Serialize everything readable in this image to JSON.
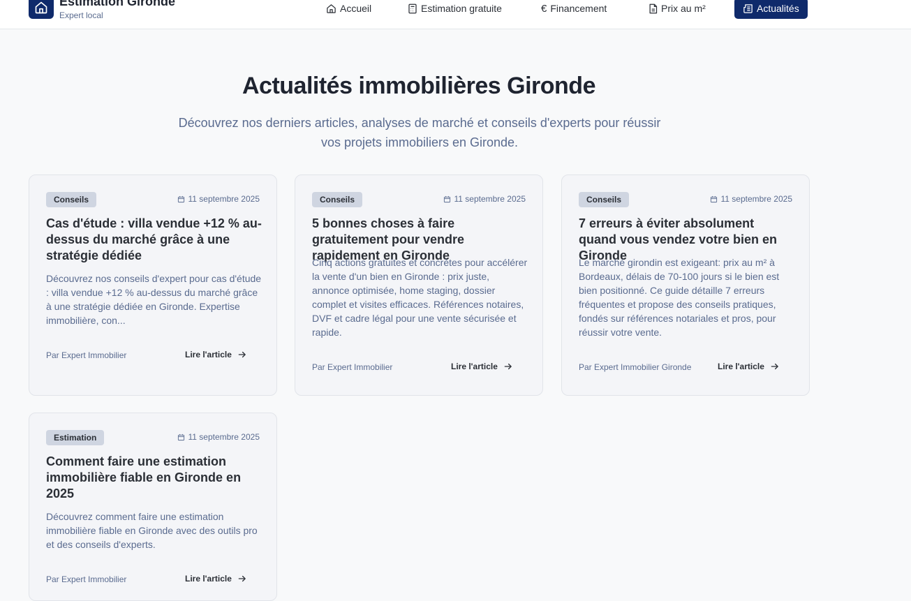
{
  "brand": {
    "title": "Estimation Gironde",
    "subtitle": "Expert local",
    "icon": "home-icon"
  },
  "nav": [
    {
      "label": "Accueil",
      "icon": "home-icon",
      "active": false
    },
    {
      "label": "Estimation gratuite",
      "icon": "calculator-icon",
      "active": false
    },
    {
      "label": "Financement",
      "icon": "euro-icon",
      "active": false
    },
    {
      "label": "Prix au m²",
      "icon": "document-icon",
      "active": false
    },
    {
      "label": "Actualités",
      "icon": "newspaper-icon",
      "active": true
    }
  ],
  "page": {
    "title": "Actualités immobilières Gironde",
    "intro": "Découvrez nos derniers articles, analyses de marché et conseils d'experts pour réussir vos projets immobiliers en Gironde."
  },
  "articles": [
    {
      "category": "Conseils",
      "date": "11 septembre 2025",
      "title": "Cas d'étude : villa vendue +12 % au-dessus du marché grâce à une stratégie dédiée",
      "excerpt": "Découvrez nos conseils d'expert pour cas d'étude : villa vendue +12 % au-dessus du marché grâce à une stratégie dédiée en Gironde. Expertise immobilière, con...",
      "author": "Par Expert Immobilier",
      "cta": "Lire l'article"
    },
    {
      "category": "Conseils",
      "date": "11 septembre 2025",
      "title": "5 bonnes choses à faire gratuitement pour vendre rapidement en Gironde",
      "excerpt": "Cinq actions gratuites et concrètes pour accélérer la vente d'un bien en Gironde : prix juste, annonce optimisée, home staging, dossier complet et visites efficaces. Références notaires, DVF et cadre légal pour une vente sécurisée et rapide.",
      "author": "Par Expert Immobilier",
      "cta": "Lire l'article"
    },
    {
      "category": "Conseils",
      "date": "11 septembre 2025",
      "title": "7 erreurs à éviter absolument quand vous vendez votre bien en Gironde",
      "excerpt": "Le marché girondin est exigeant: prix au m² à Bordeaux, délais de 70-100 jours si le bien est bien positionné. Ce guide détaille 7 erreurs fréquentes et propose des conseils pratiques, fondés sur références notariales et pros, pour réussir votre vente.",
      "author": "Par Expert Immobilier Gironde",
      "cta": "Lire l'article"
    },
    {
      "category": "Estimation",
      "date": "11 septembre 2025",
      "title": "Comment faire une estimation immobilière fiable en Gironde en 2025",
      "excerpt": "Découvrez comment faire une estimation immobilière fiable en Gironde avec des outils pro et des conseils d'experts.",
      "author": "Par Expert Immobilier",
      "cta": "Lire l'article"
    }
  ],
  "colors": {
    "primary": "#0f2a6b",
    "muted_text": "#5a6b8f",
    "badge_bg": "#cfd5e1",
    "card_bg": "#f4f5f8"
  }
}
